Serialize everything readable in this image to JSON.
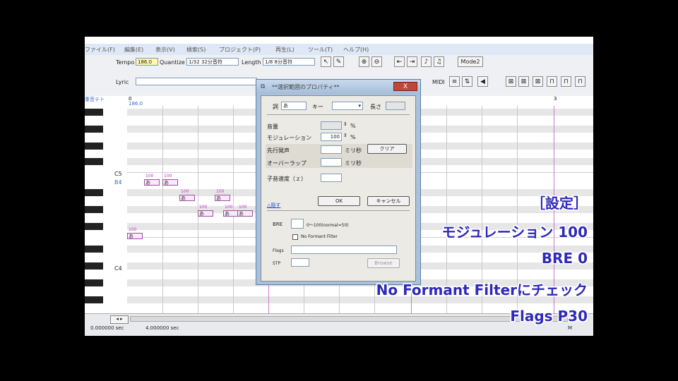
{
  "menu": [
    "ファイル(F)",
    "編集(E)",
    "表示(V)",
    "検索(S)",
    "プロジェクト(P)",
    "再生(L)",
    "ツール(T)",
    "ヘルプ(H)"
  ],
  "toolbar": {
    "tempo_label": "Tempo",
    "tempo_value": "186.0",
    "quantize_label": "Quantize",
    "quantize_value": "1/32 32分音符",
    "length_label": "Length",
    "length_value": "1/8 8分音符",
    "mode_label": "Mode2",
    "lyric_label": "Lyric",
    "midi_label": "MIDI"
  },
  "track_label": "重音テト",
  "ruler": {
    "bar_start": "0",
    "bar_end": "3",
    "tempo_marker": "186.0"
  },
  "keys": {
    "c5": "C5",
    "b4": "B4",
    "c4": "C4"
  },
  "notes": [
    {
      "lyric": "あ",
      "value": "100"
    },
    {
      "lyric": "あ",
      "value": "100"
    },
    {
      "lyric": "あ",
      "value": "100"
    },
    {
      "lyric": "あ",
      "value": "100"
    },
    {
      "lyric": "あ",
      "value": "100"
    },
    {
      "lyric": "あ",
      "value": "100"
    },
    {
      "lyric": "あ",
      "value": "100"
    },
    {
      "lyric": "あ",
      "value": "100"
    }
  ],
  "dialog": {
    "title": "**選択範囲のプロパティ**",
    "close": "X",
    "lyric_label": "詞",
    "lyric_value": "あ",
    "key_label": "キー",
    "length_label": "長さ",
    "volume_label": "音量",
    "volume_unit": "%",
    "modulation_label": "モジュレーション",
    "modulation_value": "100",
    "modulation_unit": "%",
    "preutterance_label": "先行発声",
    "preutterance_unit": "ミリ秒",
    "clear_button": "クリア",
    "overlap_label": "オーバーラップ",
    "overlap_unit": "ミリ秒",
    "consonant_label": "子音速度（ｚ）",
    "advanced_link": "△隠す",
    "ok_button": "OK",
    "cancel_button": "キャンセル",
    "bre_label": "BRE",
    "bre_range": "0～100(normal=50)",
    "no_formant_label": "No Formant Filter",
    "flags_label": "Flags",
    "stp_label": "STP",
    "browse_button": "Browse"
  },
  "status": {
    "time_start": "0.000000 sec",
    "time_end": "4.000000 sec",
    "zoom_label": "M"
  },
  "subtitles": [
    "［設定］",
    "モジュレーション 100",
    "BRE 0",
    "No Formant Filterにチェック",
    "Flags P30"
  ]
}
